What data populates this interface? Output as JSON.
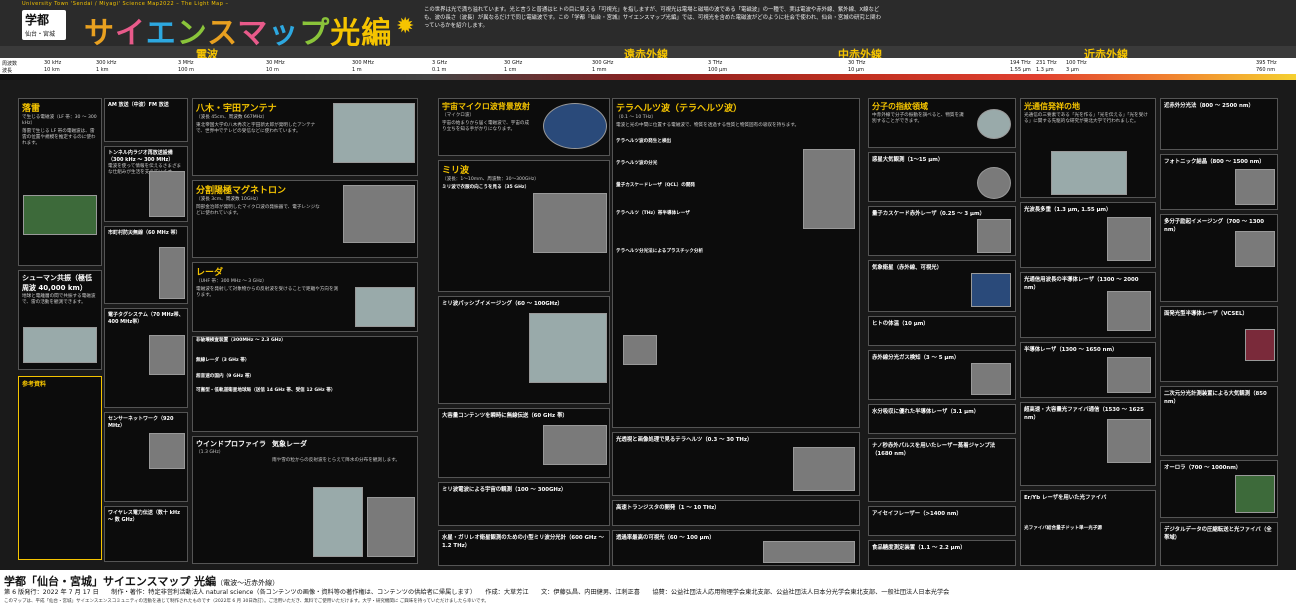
{
  "header": {
    "tagline": "University Town 'Sendai / Miyagi' Science Map2022 – The Light Map –",
    "logo_line1": "学都",
    "logo_line2": "仙台・宮城",
    "title_parts": [
      "サ",
      "イ",
      "エ",
      "ン",
      "ス",
      "マ",
      "ッ",
      "プ",
      "光編"
    ],
    "intro": "この世界は光で満ち溢れています。光と言うと普通はヒトの目に見える「可視光」を指しますが、可視光は電場と磁場の波である「電磁波」の一種で、実は電波や赤外線、紫外線、X線なども、波の長さ（波長）が異なるだけで同じ電磁波です。この「学都『仙台・宮城』サイエンスマップ光編」では、可視光を含めた電磁波がどのように社会で使われ、仙台・宮城の研究と関わっているかを紹介します。"
  },
  "bands": [
    "電波",
    "遠赤外線",
    "中赤外線",
    "近赤外線"
  ],
  "scale": {
    "freq_label": "周波数",
    "wave_label": "波長",
    "freq": [
      "30 kHz",
      "300 kHz",
      "3 MHz",
      "30 MHz",
      "300 MHz",
      "3 GHz",
      "30 GHz",
      "300 GHz",
      "3 THz",
      "30 THz",
      "100 THz",
      "395 THz"
    ],
    "wave": [
      "10 km",
      "1 km",
      "100 m",
      "10 m",
      "1 m",
      "0.1 m",
      "1 cm",
      "1 mm",
      "100 µm",
      "10 µm",
      "3 µm",
      "760 nm"
    ],
    "extra_freq": [
      "194 THz",
      "231 THz"
    ],
    "extra_wave": [
      "1.55 µm",
      "1.3 µm"
    ]
  },
  "col1": {
    "title": "落雷",
    "sub": "で生じる電磁波（LF 帯：30 〜 300 kHz）",
    "text": "落雷で生じる LF 帯の電磁波は、雷雲の位置や規模を推定するのに使われます。",
    "box2": "シューマン共振（極低周波 40,000 km）",
    "box2_text": "地球と電離層の間で共振する電磁波で、雷の活動を観測できます。",
    "note": "参考資料"
  },
  "col2": {
    "b1": "AM 放送（中波）FM 放送",
    "b2": "トンネル内ラジオ再放送設備（300 kHz 〜 300 MHz）",
    "b3": "市町村防災無線（60 MHz 帯）",
    "b4": "電子タグシステム（70 MHz帯、400 MHz帯）",
    "b5": "センサーネットワーク（920 MHz）",
    "b6": "ワイヤレス電力伝送（数十 kHz 〜 数 GHz）",
    "text": "電波を使って情報を伝えるさまざまな仕組みが生活を支えています。"
  },
  "col3": {
    "h1": "八木・宇田アンテナ",
    "s1": "（波長 45cm、周波数 667MHz）",
    "t1": "東北帝国大学の八木秀次と宇田新太郎が発明したアンテナで、世界中でテレビの受信などに使われています。",
    "h2": "分割陽極マグネトロン",
    "s2": "（波長 3cm、周波数 10GHz）",
    "t2": "岡部金治郎が発明したマイクロ波の発振器で、電子レンジなどに使われています。",
    "h3": "レーダ",
    "s3": "（UHF 帯：300 MHz 〜 3 GHz）",
    "t3": "電磁波を発射して対象物からの反射波を受けることで距離や方向を測ります。",
    "h4a": "非破壊検査装置（300MHz 〜 2.3 GHz）",
    "h4b": "無線レーダ（3 GHz 帯）",
    "h4c": "超音速の国内（9 GHz 帯）",
    "h4d": "可搬型・低軌道衛星地球局（送信 14 GHz 帯、受信 12 GHz 帯）",
    "h5": "ウインドプロファイラ",
    "s5": "（1.3 GHz）",
    "h6": "気象レーダ",
    "s6": "（5 GHz）",
    "t6": "雨や雪の粒からの反射波をとらえて降水の分布を観測します。"
  },
  "col4": {
    "h1": "宇宙マイクロ波背景放射",
    "s1": "（マイクロ波）",
    "t1": "宇宙の始まりから届く電磁波で、宇宙の成り立ちを知る手がかりになります。",
    "h2": "ミリ波",
    "s2": "（波長：1〜10mm、周波数：30〜300GHz）",
    "b1": "ミリ波で衣服の向こうを見る（35 GHz）",
    "b2": "ミリ波パッシブイメージング（60 〜 100GHz）",
    "b3": "大容量コンテンツを瞬時に無線伝送（60 GHz 帯）",
    "b4": "ミリ波電波による宇宙の観測（100 〜 300GHz）",
    "b5": "水星・ガリレオ衛星観測のための小型ミリ波分光計（600 GHz 〜 1.2 THz）"
  },
  "col5": {
    "h1": "テラヘルツ波（テラヘルツ波）",
    "s1": "（0.1 〜 10 THz）",
    "t1": "電波と光の中間に位置する電磁波で、物質を透過する性質と物質固有の吸収を持ちます。",
    "b1": "テラヘルツ波の発生と検出",
    "b2": "テラヘルツ波の分光",
    "b3": "量子カスケードレーザ（QCL）の開発",
    "b4": "テラヘルツ（THz）帯半導体レーザ",
    "b5": "テラヘルツ分光法によるプラスチック分析",
    "b6": "光透視と画像処理で見るテラヘルツ（0.3 〜 30 THz）",
    "b7": "高速トランジスタの開発（1 〜 10 THz）",
    "b8": "透過率最高の可視光（60 〜 100 µm）"
  },
  "col6": {
    "h1": "分子の指紋領域",
    "t1": "中赤外線で分子の振動を調べると、物質を識別することができます。",
    "b1": "惑星大気観測（1〜15 µm）",
    "b2": "量子カスケード赤外レーザ（0.25 〜 3 µm）",
    "b3": "気象衛星（赤外線、可視光）",
    "b4": "ヒトの体温（10 µm）",
    "b5": "赤外線分光ガス検知（3 〜 5 µm）",
    "b6": "水分吸収に優れた半導体レーザ（3.1 µm）",
    "b7": "ナノ秒赤外パルスを用いたレーザー蒸着ジャンプ法（1680 nm）",
    "b8": "アイセイフレーザー（>1400 nm）",
    "b9": "食品糖度測定装置（1.1 〜 2.2 µm）"
  },
  "col7": {
    "h1": "光通信発祥の地",
    "t1": "光通信の三要素である「光を作る」「光を伝える」「光を受ける」に関する先駆的な研究が東北大学で行われました。",
    "b1": "光波長多重（1.3 µm, 1.55 µm）",
    "b2": "光通信用波長の半導体レーザ（1300 〜 2000 nm）",
    "b3": "半導体レーザ（1300 〜 1650 nm）",
    "b4": "超高速・大容量光ファイバ通信（1530 〜 1625 nm）",
    "b5": "Er/Yb レーザを用いた光ファイバ",
    "b6": "光ファイバ結合量子ドット単一光子源"
  },
  "col8": {
    "b1": "近赤外分光法（800 〜 2500 nm）",
    "b2": "フォトニック結晶（800 〜 1500 nm）",
    "b3": "多分子励起イメージング（700 〜 1300 nm）",
    "b4": "面発光型半導体レーザ（VCSEL）",
    "b5": "二次元分光計測装置による大気観測（850 nm）",
    "b6": "オーロラ（700 〜 1000nm）",
    "b7": "デジタルデータの圧縮転送と光ファイバ（全帯域）"
  },
  "footer": {
    "title": "学都「仙台・宮城」サイエンスマップ 光編",
    "title_small": "（電波〜近赤外線）",
    "line2": "第 6 版発行：2022 年 7 月 17 日　　制作・著作：特定非営利活動法人 natural science（各コンテンツの画像・資料等の著作権は、コンテンツの供給者に帰属します）　　作成：大草芳江　　文：伊藤弘昌、内田健男、江刺正喜　　協賛：公益社団法人応用物理学会東北支部、公益社団法人日本分光学会東北支部、一般社団法人日本光学会",
    "line3": "このマップは、平成「仙台・宮城」サイエンスエンスコミュニティの活動を通じて制作されたものです（2022年 6 月 30日改訂）。ご活用いただき、無料でご使用いただけます。大学・研究機関に ご興味を持っていただけましたら幸いです。"
  },
  "colors": {
    "accent": "#f5c400",
    "bg": "#1a1a1a"
  }
}
